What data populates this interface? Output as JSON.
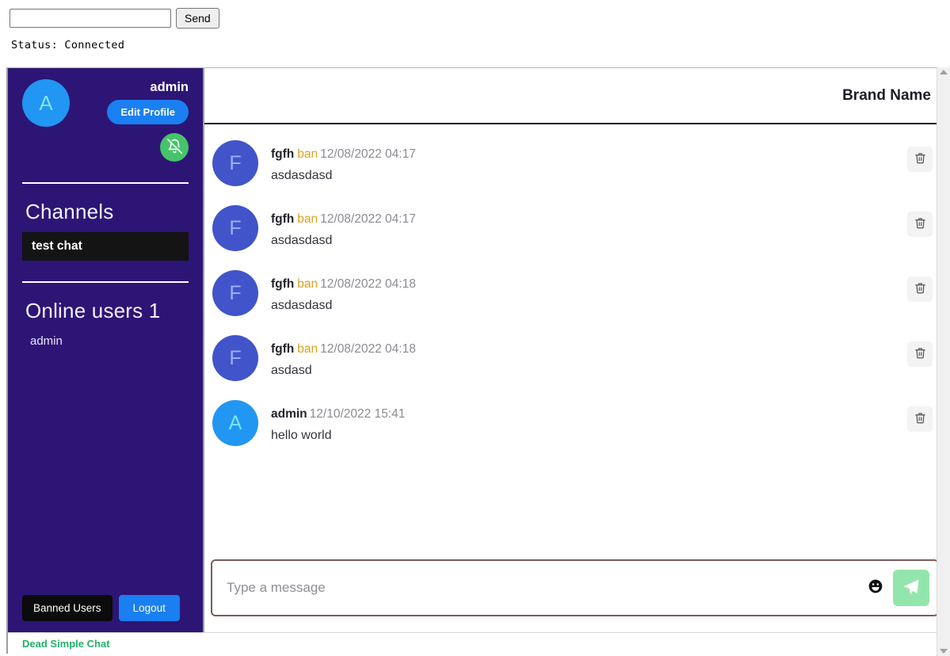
{
  "topbar": {
    "input_value": "",
    "input_placeholder": "",
    "send_label": "Send",
    "status_text": "Status: Connected"
  },
  "sidebar": {
    "profile": {
      "avatar_initial": "A",
      "username": "admin",
      "edit_profile_label": "Edit Profile",
      "notification_icon": "bell-off-icon"
    },
    "channels_title": "Channels",
    "channels": [
      {
        "label": "test chat",
        "active": true
      }
    ],
    "online_title": "Online users 1",
    "online_users": [
      {
        "label": "admin"
      }
    ],
    "footer": {
      "banned_users_label": "Banned Users",
      "logout_label": "Logout"
    }
  },
  "brand_footer": "Dead Simple Chat",
  "main": {
    "header": {
      "brand_name": "Brand Name"
    },
    "messages": [
      {
        "avatar_initial": "F",
        "avatar_style": "av-indigo",
        "username": "fgfh",
        "ban_label": "ban",
        "timestamp": "12/08/2022 04:17",
        "text": "asdasdasd",
        "delete_icon": "trash-icon"
      },
      {
        "avatar_initial": "F",
        "avatar_style": "av-indigo",
        "username": "fgfh",
        "ban_label": "ban",
        "timestamp": "12/08/2022 04:17",
        "text": "asdasdasd",
        "delete_icon": "trash-icon"
      },
      {
        "avatar_initial": "F",
        "avatar_style": "av-indigo",
        "username": "fgfh",
        "ban_label": "ban",
        "timestamp": "12/08/2022 04:18",
        "text": "asdasdasd",
        "delete_icon": "trash-icon"
      },
      {
        "avatar_initial": "F",
        "avatar_style": "av-indigo",
        "username": "fgfh",
        "ban_label": "ban",
        "timestamp": "12/08/2022 04:18",
        "text": "asdasd",
        "delete_icon": "trash-icon"
      },
      {
        "avatar_initial": "A",
        "avatar_style": "av-blue",
        "username": "admin",
        "ban_label": "",
        "timestamp": "12/10/2022 15:41",
        "text": "hello world",
        "delete_icon": "trash-icon"
      }
    ],
    "composer": {
      "placeholder": "Type a message",
      "value": "",
      "emoji_icon": "emoji-smiley-icon",
      "send_icon": "paper-plane-icon"
    }
  },
  "colors": {
    "sidebar_bg": "#2d1575",
    "accent_blue": "#1a7ff0",
    "ban_amber": "#d9a322",
    "brand_green": "#23b06b",
    "send_green": "#93e6ab",
    "bell_green": "#45c469"
  }
}
